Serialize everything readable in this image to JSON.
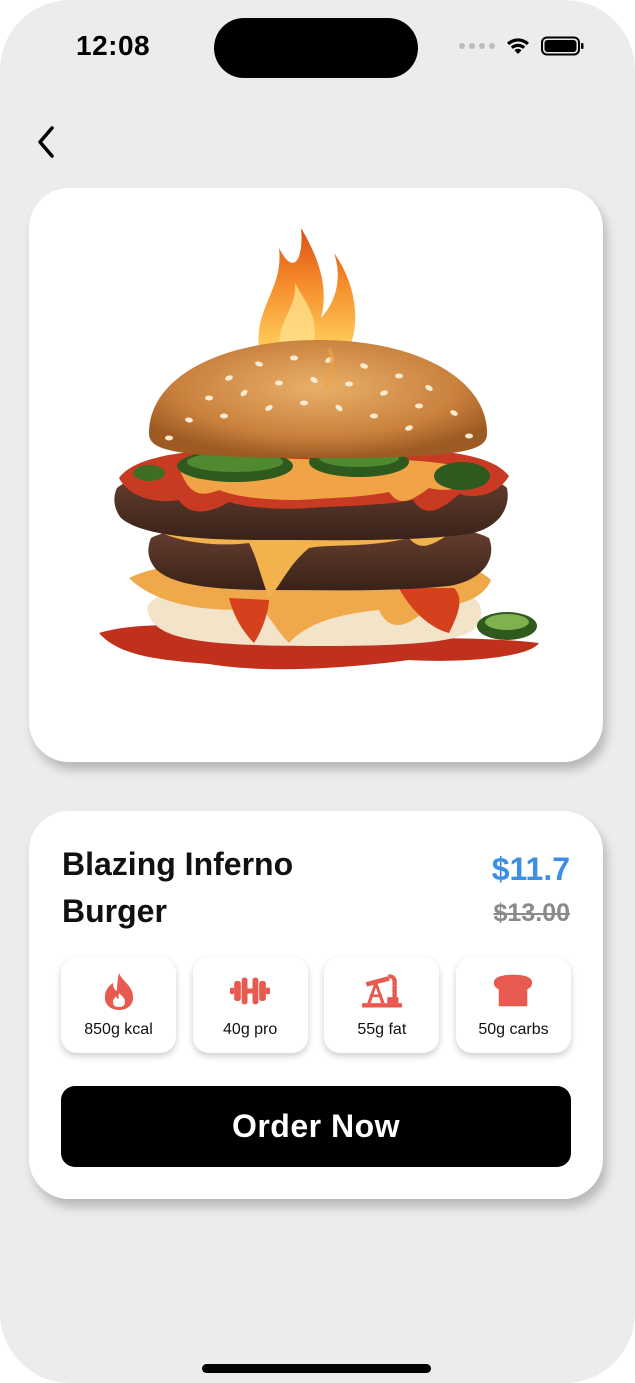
{
  "status_bar": {
    "time": "12:08"
  },
  "nav": {
    "back_icon": "chevron-left-icon"
  },
  "product": {
    "name": "Blazing Inferno Burger",
    "price": "$11.7",
    "old_price": "$13.00",
    "image": "burger-image"
  },
  "nutrients": [
    {
      "icon": "flame-icon",
      "label": "850g kcal"
    },
    {
      "icon": "dumbbell-icon",
      "label": "40g pro"
    },
    {
      "icon": "oil-pump-icon",
      "label": "55g fat"
    },
    {
      "icon": "bread-icon",
      "label": "50g carbs"
    }
  ],
  "order_button": {
    "label": "Order Now"
  },
  "colors": {
    "accent_price": "#3d8fe6",
    "nutrient_icon": "#e85a4f",
    "background": "#ececec"
  }
}
